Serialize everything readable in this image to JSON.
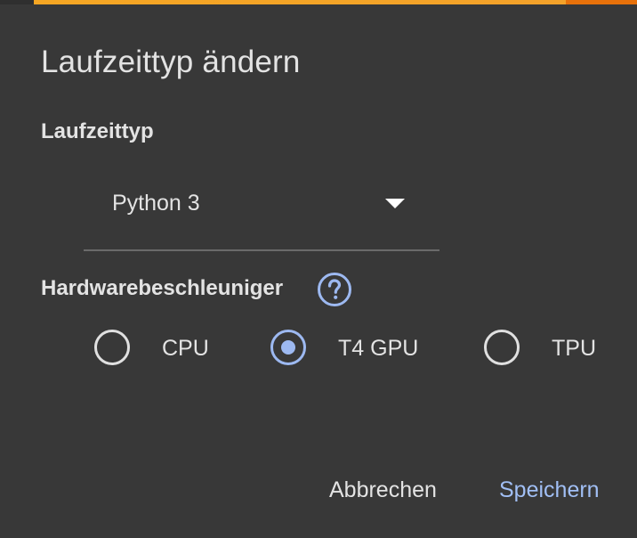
{
  "dialog": {
    "title": "Laufzeittyp ändern"
  },
  "runtime": {
    "label": "Laufzeittyp",
    "selected": "Python 3"
  },
  "hardware": {
    "label": "Hardwarebeschleuniger",
    "help_icon": "help-circle-icon",
    "options": [
      {
        "label": "CPU",
        "checked": false
      },
      {
        "label": "T4 GPU",
        "checked": true
      },
      {
        "label": "TPU",
        "checked": false
      }
    ]
  },
  "actions": {
    "cancel_label": "Abbrechen",
    "save_label": "Speichern"
  },
  "colors": {
    "background": "#383838",
    "accent": "#9db9f1",
    "top_bar": "#f5a623"
  }
}
